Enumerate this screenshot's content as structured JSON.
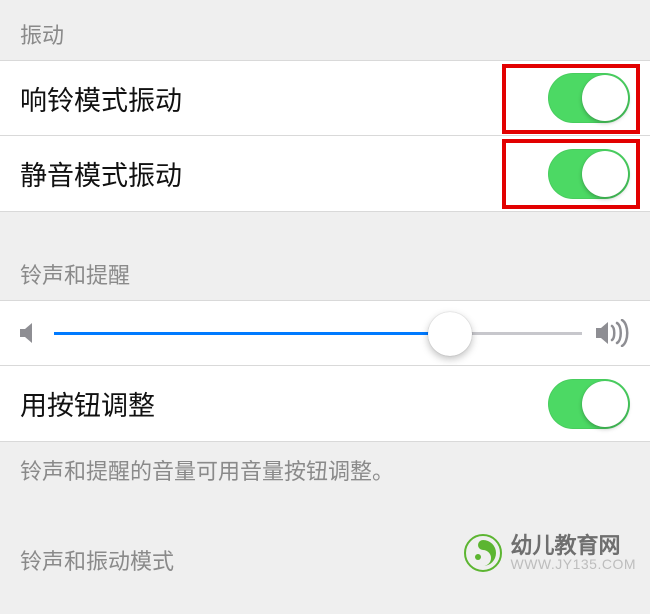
{
  "sections": {
    "vibration_header": "振动",
    "ringtone_header": "铃声和提醒",
    "pattern_header": "铃声和振动模式"
  },
  "rows": {
    "vibrate_on_ring": "响铃模式振动",
    "vibrate_on_silent": "静音模式振动",
    "change_with_buttons": "用按钮调整"
  },
  "toggles": {
    "vibrate_on_ring": true,
    "vibrate_on_silent": true,
    "change_with_buttons": true
  },
  "volume": {
    "value_percent": 75
  },
  "footer_note": "铃声和提醒的音量可用音量按钮调整。",
  "watermark": {
    "title": "幼儿教育网",
    "url": "WWW.JY135.COM"
  },
  "colors": {
    "toggle_on": "#4cd964",
    "slider_fill": "#007aff",
    "highlight": "#e20000"
  }
}
